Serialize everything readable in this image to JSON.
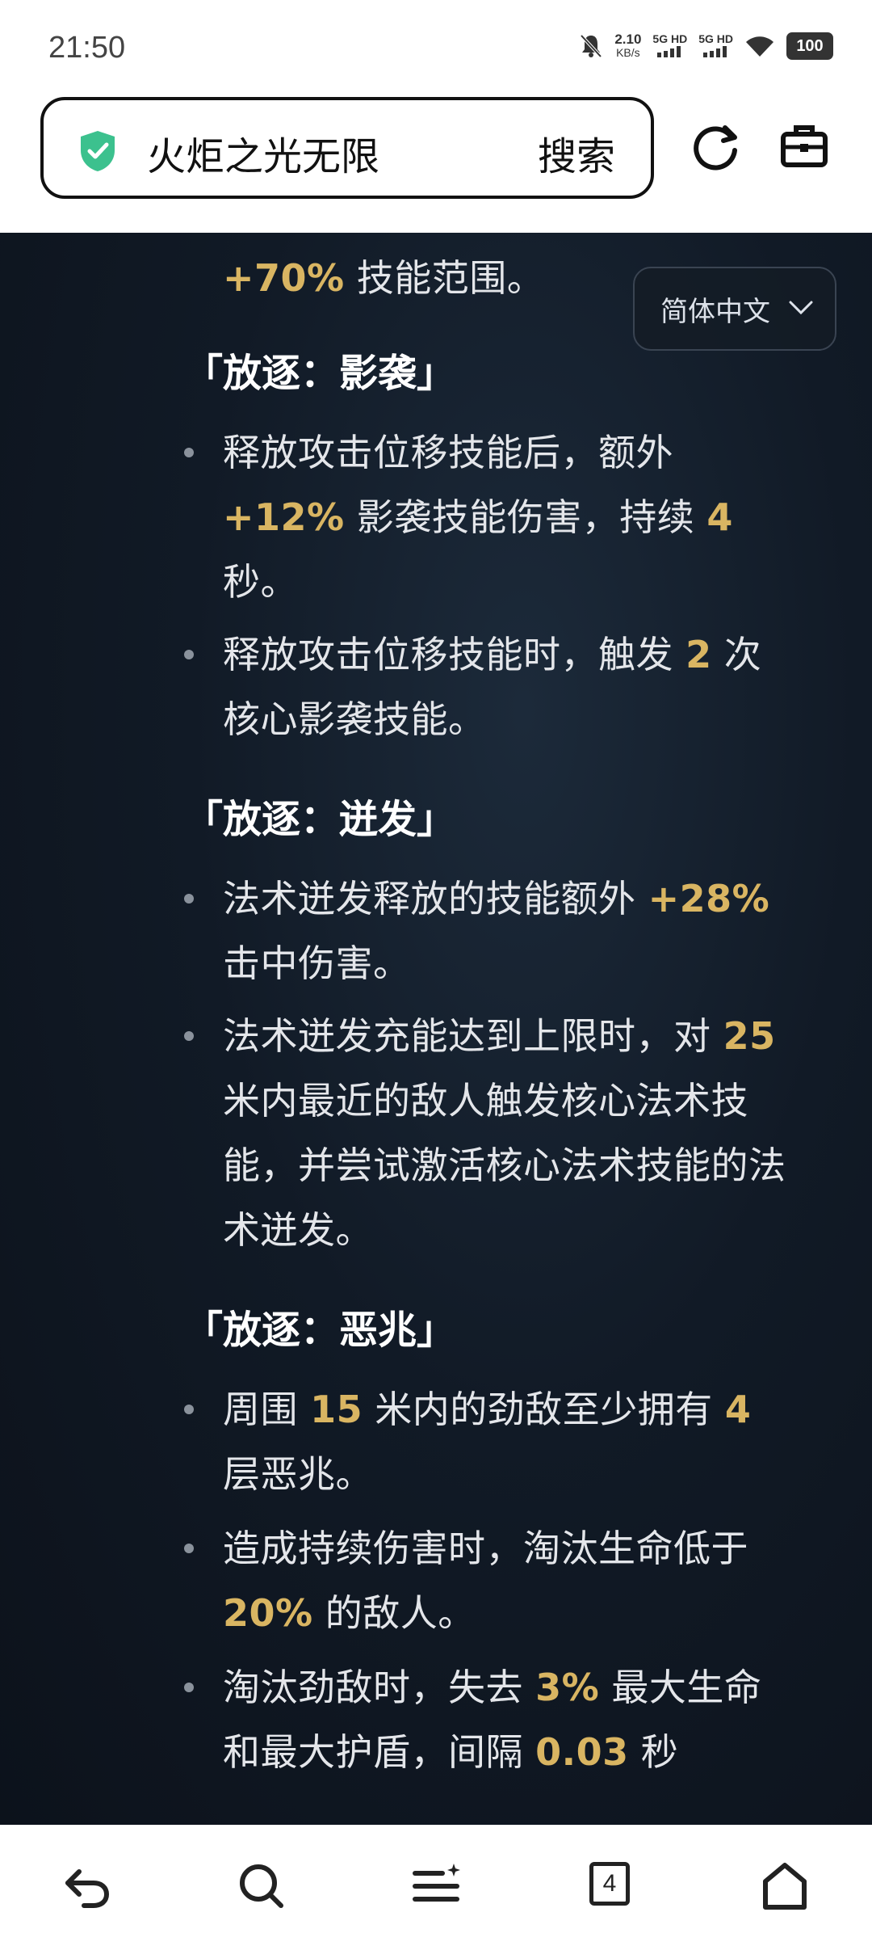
{
  "status_bar": {
    "time": "21:50",
    "net_speed_value": "2.10",
    "net_speed_unit": "KB/s",
    "sim1": "5G HD",
    "sim2": "5G HD",
    "battery": "100"
  },
  "browser": {
    "search_query": "火炬之光无限",
    "search_button": "搜索",
    "tab_count": "4"
  },
  "language_selector": {
    "value": "简体中文"
  },
  "content": {
    "intro_line": {
      "value": "+70%",
      "text": " 技能范围。"
    },
    "sections": [
      {
        "title": "「放逐：影袭」",
        "bullets": [
          [
            "释放攻击位移技能后，额外",
            "+12% 影袭技能伤害，持续 4",
            "秒。"
          ],
          [
            "释放攻击位移技能时，触发 2 次",
            "核心影袭技能。"
          ]
        ]
      },
      {
        "title": "「放逐：迸发」",
        "bullets": [
          [
            "法术迸发释放的技能额外 +28%",
            "击中伤害。"
          ],
          [
            "法术迸发充能达到上限时，对 25",
            "米内最近的敌人触发核心法术技",
            "能，并尝试激活核心法术技能的法",
            "术迸发。"
          ]
        ]
      },
      {
        "title": "「放逐：恶兆」",
        "bullets": [
          [
            "周围 15 米内的劲敌至少拥有 4",
            "层恶兆。"
          ],
          [
            "造成持续伤害时，淘汰生命低于",
            "20% 的敌人。"
          ],
          [
            "淘汰劲敌时，失去 3% 最大生命",
            "和最大护盾，间隔 0.03 秒"
          ]
        ]
      }
    ]
  },
  "colors": {
    "highlight": "#d9b562",
    "background": "#111a26",
    "text": "#e4e6ea"
  },
  "icons": [
    "shield-check-icon",
    "refresh-icon",
    "briefcase-icon",
    "back-icon",
    "search-icon",
    "menu-icon",
    "tabs-icon",
    "home-icon",
    "chevron-down-icon"
  ]
}
